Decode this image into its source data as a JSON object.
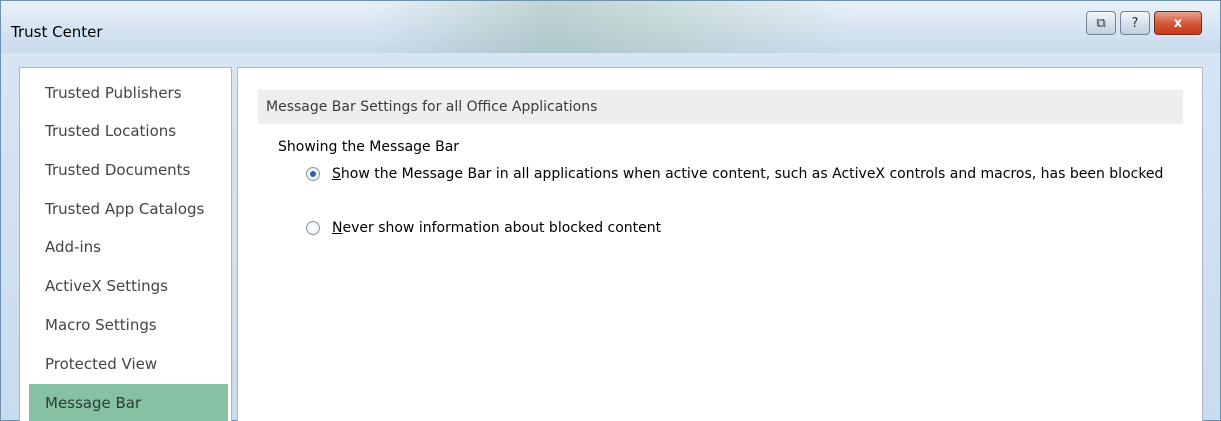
{
  "window": {
    "title": "Trust Center",
    "buttons": {
      "restore": "⧉",
      "help": "?",
      "close": "x"
    }
  },
  "sidebar": {
    "items": [
      {
        "label": "Trusted Publishers"
      },
      {
        "label": "Trusted Locations"
      },
      {
        "label": "Trusted Documents"
      },
      {
        "label": "Trusted App Catalogs"
      },
      {
        "label": "Add-ins"
      },
      {
        "label": "ActiveX Settings"
      },
      {
        "label": "Macro Settings"
      },
      {
        "label": "Protected View"
      },
      {
        "label": "Message Bar",
        "selected": true
      }
    ]
  },
  "main": {
    "section_header": "Message Bar Settings for all Office Applications",
    "group_label": "Showing the Message Bar",
    "options": [
      {
        "accel": "S",
        "rest": "how the Message Bar in all applications when active content, such as ActiveX controls and macros, has been blocked",
        "selected": true
      },
      {
        "accel": "N",
        "rest": "ever show information about blocked content",
        "selected": false
      }
    ]
  },
  "colors": {
    "selected_sidebar": "#86c1a2",
    "radio_dot": "#2a63a6",
    "close_button": "#c33b1c"
  },
  "icons": [
    "restore-icon",
    "help-icon",
    "close-icon",
    "radio-selected-icon",
    "radio-unselected-icon"
  ]
}
